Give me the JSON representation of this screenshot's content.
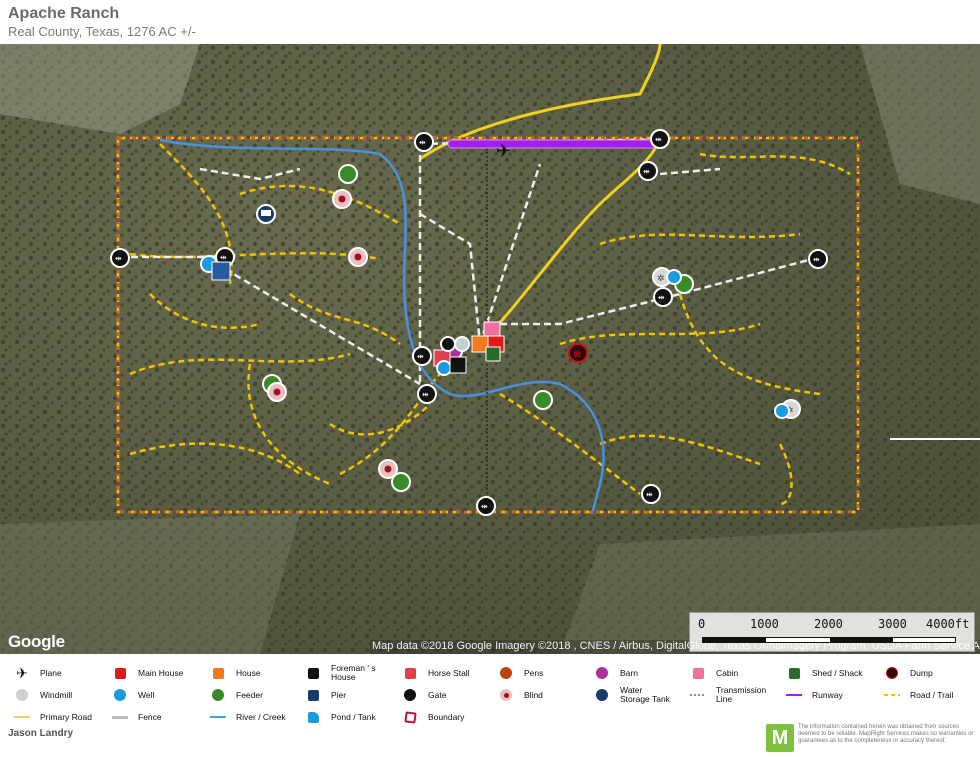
{
  "header": {
    "title": "Apache Ranch",
    "subtitle": "Real County, Texas, 1276 AC +/-"
  },
  "map": {
    "provider_logo": "Google",
    "attribution": "Map data ©2018 Google  Imagery ©2018 , CNES / Airbus, DigitalGlobe, Texas Orthoimagery Program, USDA Farm Service Agency",
    "scale": {
      "labels": [
        "0",
        "1000",
        "2000",
        "3000",
        "4000ft"
      ]
    },
    "colors": {
      "boundary": "#d0143c",
      "primary_road": "#f0d020",
      "trail": "#f5c400",
      "fence": "#e8e8e8",
      "creek": "#4a8fe0",
      "runway": "#a020f0"
    }
  },
  "legend": {
    "items": [
      {
        "label": "Plane",
        "icon": "plane-icon"
      },
      {
        "label": "Main House",
        "icon": "main-house-icon"
      },
      {
        "label": "House",
        "icon": "house-icon"
      },
      {
        "label": "Foreman ' s House",
        "icon": "foreman-house-icon"
      },
      {
        "label": "Horse Stall",
        "icon": "horse-stall-icon"
      },
      {
        "label": "Pens",
        "icon": "pens-icon"
      },
      {
        "label": "Barn",
        "icon": "barn-icon"
      },
      {
        "label": "Cabin",
        "icon": "cabin-icon"
      },
      {
        "label": "Shed / Shack",
        "icon": "shed-icon"
      },
      {
        "label": "Dump",
        "icon": "dump-icon"
      },
      {
        "label": "Windmill",
        "icon": "windmill-icon"
      },
      {
        "label": "Well",
        "icon": "well-icon"
      },
      {
        "label": "Feeder",
        "icon": "feeder-icon"
      },
      {
        "label": "Pier",
        "icon": "pier-icon"
      },
      {
        "label": "Gate",
        "icon": "gate-icon"
      },
      {
        "label": "Blind",
        "icon": "blind-icon"
      },
      {
        "label": "Water Storage Tank",
        "icon": "water-tank-icon"
      },
      {
        "label": "Transmission Line",
        "icon": "transmission-line-icon"
      },
      {
        "label": "Runway",
        "icon": "runway-icon"
      },
      {
        "label": "Road / Trail",
        "icon": "road-trail-icon"
      },
      {
        "label": "Primary Road",
        "icon": "primary-road-icon"
      },
      {
        "label": "Fence",
        "icon": "fence-icon"
      },
      {
        "label": "River / Creek",
        "icon": "river-icon"
      },
      {
        "label": "Pond / Tank",
        "icon": "pond-icon"
      },
      {
        "label": "Boundary",
        "icon": "boundary-icon"
      }
    ]
  },
  "footer": {
    "author": "Jason Landry",
    "logo_letter": "M",
    "disclaimer": "The information contained herein was obtained from sources deemed to be reliable. MapRight Services makes no warranties or guarantees as to the completeness or accuracy thereof."
  }
}
